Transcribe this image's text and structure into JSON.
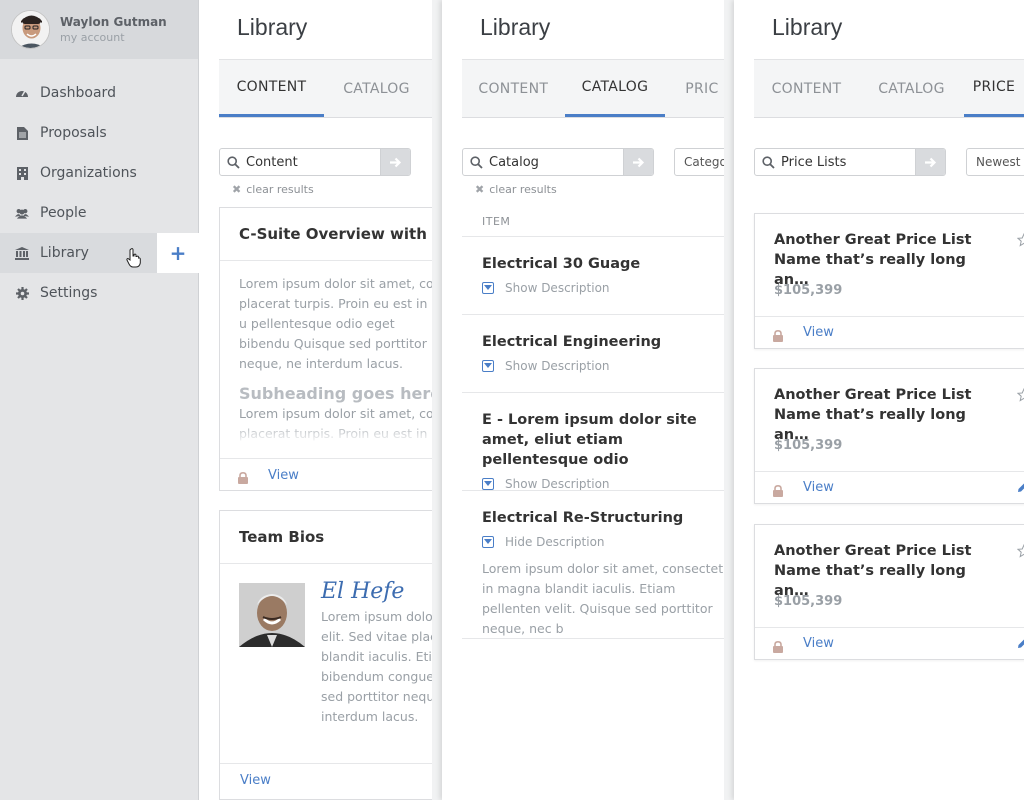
{
  "account": {
    "name": "Waylon Gutman",
    "sub": "my account"
  },
  "nav": [
    {
      "label": "Dashboard",
      "icon": "dashboard-icon"
    },
    {
      "label": "Proposals",
      "icon": "document-icon"
    },
    {
      "label": "Organizations",
      "icon": "building-icon"
    },
    {
      "label": "People",
      "icon": "people-icon"
    },
    {
      "label": "Library",
      "icon": "library-icon",
      "active": true
    },
    {
      "label": "Settings",
      "icon": "gear-icon"
    }
  ],
  "add_label": "+",
  "panel1": {
    "title": "Library",
    "tabs": [
      "CONTENT",
      "CATALOG"
    ],
    "active_tab": "CONTENT",
    "search_value": "Content",
    "clear_label": "clear results",
    "card1": {
      "title": "C-Suite Overview with em",
      "body": "Lorem ipsum dolor sit amet, co placerat turpis. Proin eu est in u pellentesque odio eget bibendu Quisque sed porttitor neque, ne interdum lacus.",
      "subheading": "Subheading goes here",
      "body2": "Lorem ipsum dolor sit amet, co placerat turpis. Proin eu est in u",
      "view_label": "View"
    },
    "card2": {
      "title": "Team Bios",
      "name": "El Hefe",
      "body": "Lorem ipsum dolo elit. Sed vitae plac blandit iaculis. Eti bibendum congue sed porttitor nequ interdum lacus.",
      "view_label": "View"
    }
  },
  "panel2": {
    "title": "Library",
    "tabs": [
      "CONTENT",
      "CATALOG",
      "PRIC"
    ],
    "active_tab": "CATALOG",
    "search_value": "Catalog",
    "dropdown": "Catego",
    "clear_label": "clear results",
    "column_header": "ITEM",
    "items": [
      {
        "title": "Electrical 30 Guage",
        "toggle": "Show Description"
      },
      {
        "title": "Electrical Engineering",
        "toggle": "Show Description"
      },
      {
        "title": "E - Lorem ipsum dolor site amet, eliut etiam pellentesque odio",
        "toggle": "Show Description"
      },
      {
        "title": "Electrical Re-Structuring",
        "toggle": "Hide Description",
        "description": "Lorem ipsum dolor sit amet, consectetu in magna blandit iaculis. Etiam pellenten velit. Quisque sed porttitor neque, nec b"
      }
    ]
  },
  "panel3": {
    "title": "Library",
    "tabs": [
      "CONTENT",
      "CATALOG",
      "PRICE"
    ],
    "active_tab": "PRICE",
    "search_value": "Price Lists",
    "dropdown": "Newest",
    "cards": [
      {
        "title": "Another Great Price List Name that’s really long an…",
        "price": "$105,399",
        "view_label": "View",
        "editable": false
      },
      {
        "title": "Another Great Price List Name that’s really long an…",
        "price": "$105,399",
        "view_label": "View",
        "editable": true
      },
      {
        "title": "Another Great Price List Name that’s really long an…",
        "price": "$105,399",
        "view_label": "View",
        "editable": true
      }
    ]
  },
  "colors": {
    "accent": "#4a7ec7",
    "sidebar": "#e4e5e7",
    "muted": "#9aa0a6",
    "lock": "#c9a9a0"
  }
}
